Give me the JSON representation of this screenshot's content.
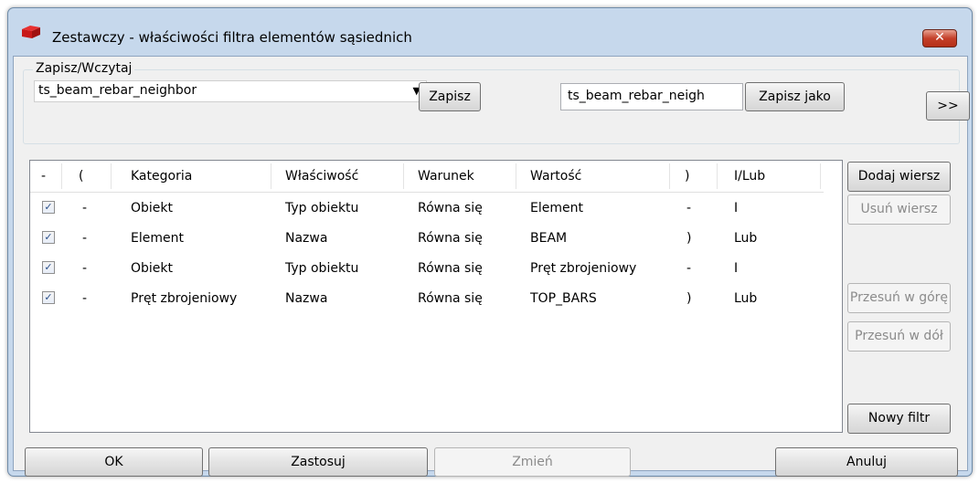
{
  "window": {
    "title": "Zestawczy - właściwości filtra elementów sąsiednich",
    "close_label": "✕"
  },
  "save_load": {
    "legend": "Zapisz/Wczytaj",
    "preset_value": "ts_beam_rebar_neighbor",
    "save_label": "Zapisz",
    "save_as_value": "ts_beam_rebar_neigh",
    "save_as_label": "Zapisz jako",
    "expand_label": ">>"
  },
  "table": {
    "headers": [
      "-",
      "(",
      "Kategoria",
      "Właściwość",
      "Warunek",
      "Wartość",
      ")",
      "I/Lub"
    ],
    "rows": [
      {
        "checked": "✓",
        "open": "-",
        "category": "Obiekt",
        "property": "Typ obiektu",
        "condition": "Równa się",
        "value": "Element",
        "close": "-",
        "andor": "I"
      },
      {
        "checked": "✓",
        "open": "-",
        "category": "Element",
        "property": "Nazwa",
        "condition": "Równa się",
        "value": "BEAM",
        "close": ")",
        "andor": "Lub"
      },
      {
        "checked": "✓",
        "open": "-",
        "category": "Obiekt",
        "property": "Typ obiektu",
        "condition": "Równa się",
        "value": "Pręt zbrojeniowy",
        "close": "-",
        "andor": "I"
      },
      {
        "checked": "✓",
        "open": "-",
        "category": "Pręt zbrojeniowy",
        "property": "Nazwa",
        "condition": "Równa się",
        "value": "TOP_BARS",
        "close": ")",
        "andor": "Lub"
      }
    ]
  },
  "side_buttons": {
    "add_row": "Dodaj wiersz",
    "remove_row": "Usuń wiersz",
    "move_up": "Przesuń w górę",
    "move_down": "Przesuń w dół",
    "new_filter": "Nowy filtr"
  },
  "bottom_buttons": {
    "ok": "OK",
    "apply": "Zastosuj",
    "modify": "Zmień",
    "cancel": "Anuluj"
  },
  "colors": {
    "frame": "#c6d8ec",
    "close_button": "#c4402a",
    "app_icon": "#d42020"
  },
  "icons": {
    "app": "tekla-red-flag-icon",
    "close": "close-icon",
    "dropdown": "triangle-down-icon",
    "checkbox": "checkmark-icon"
  }
}
